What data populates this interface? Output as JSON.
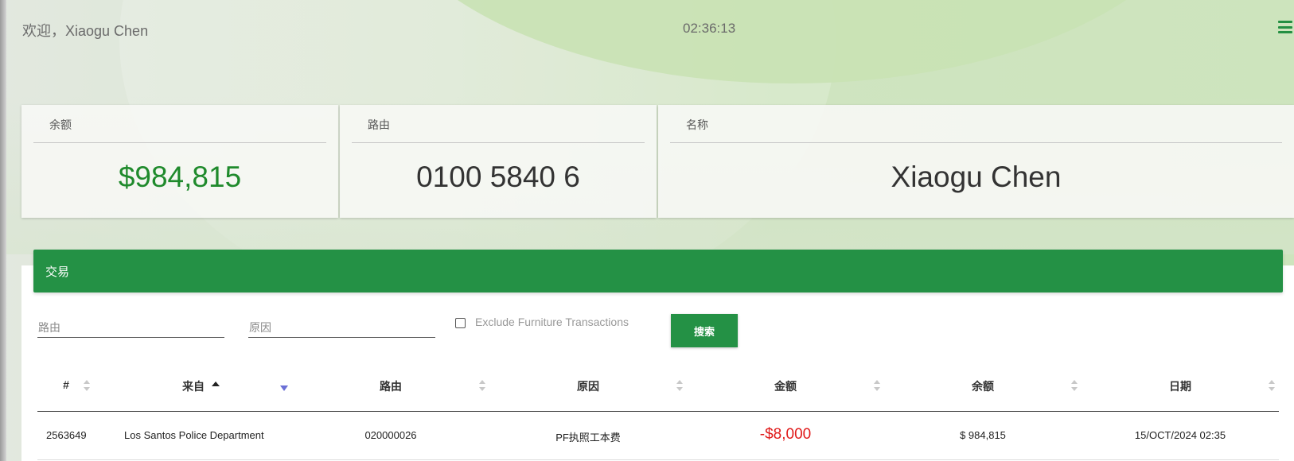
{
  "header": {
    "welcome": "欢迎，Xiaogu Chen",
    "clock": "02:36:13",
    "menu_icon": "hamburger-menu-icon"
  },
  "cards": {
    "balance": {
      "label": "余额",
      "value": "$984,815"
    },
    "routing": {
      "label": "路由",
      "value": "0100 5840 6"
    },
    "name": {
      "label": "名称",
      "value": "Xiaogu Chen"
    }
  },
  "transactions": {
    "title": "交易",
    "filters": {
      "routing_placeholder": "路由",
      "reason_placeholder": "原因",
      "exclude_label": "Exclude Furniture Transactions",
      "exclude_checked": false,
      "search_label": "搜索"
    },
    "columns": [
      "#",
      "来自",
      "路由",
      "原因",
      "金额",
      "余额",
      "日期"
    ],
    "sorted_column": "来自",
    "rows": [
      {
        "id": "2563649",
        "from": "Los Santos Police Department",
        "routing": "020000026",
        "reason": "PF执照工本费",
        "amount": "-$8,000",
        "balance": "$ 984,815",
        "date": "15/OCT/2024 02:35"
      }
    ]
  },
  "colors": {
    "accent": "#249145",
    "balance_value": "#1f8a2c",
    "negative_amount": "#e01a1a"
  }
}
